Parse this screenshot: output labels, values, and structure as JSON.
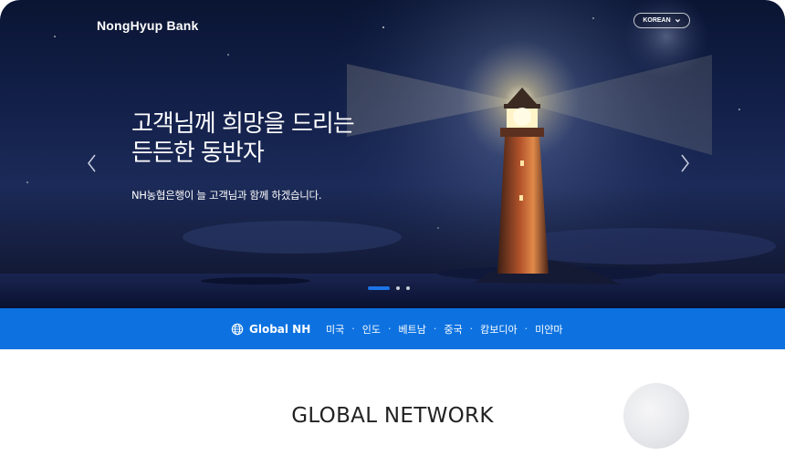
{
  "header": {
    "logo_text": "NongHyup Bank",
    "language_label": "KOREAN",
    "language_icon": "chevron-down-icon"
  },
  "hero": {
    "headline_line1": "고객님께 희망을 드리는",
    "headline_line2": "든든한 동반자",
    "subtext": "NH농협은행이 늘 고객님과 함께 하겠습니다.",
    "prev_icon": "chevron-left-icon",
    "next_icon": "chevron-right-icon",
    "slide_count": 3,
    "active_slide": 1,
    "active_color": "#1d74e6"
  },
  "global_bar": {
    "icon": "globe-icon",
    "title": "Global NH",
    "countries": [
      "미국",
      "인도",
      "베트남",
      "중국",
      "캄보디아",
      "미얀마"
    ],
    "separator": "·",
    "background": "#0d72e0"
  },
  "section": {
    "title": "GLOBAL NETWORK"
  }
}
